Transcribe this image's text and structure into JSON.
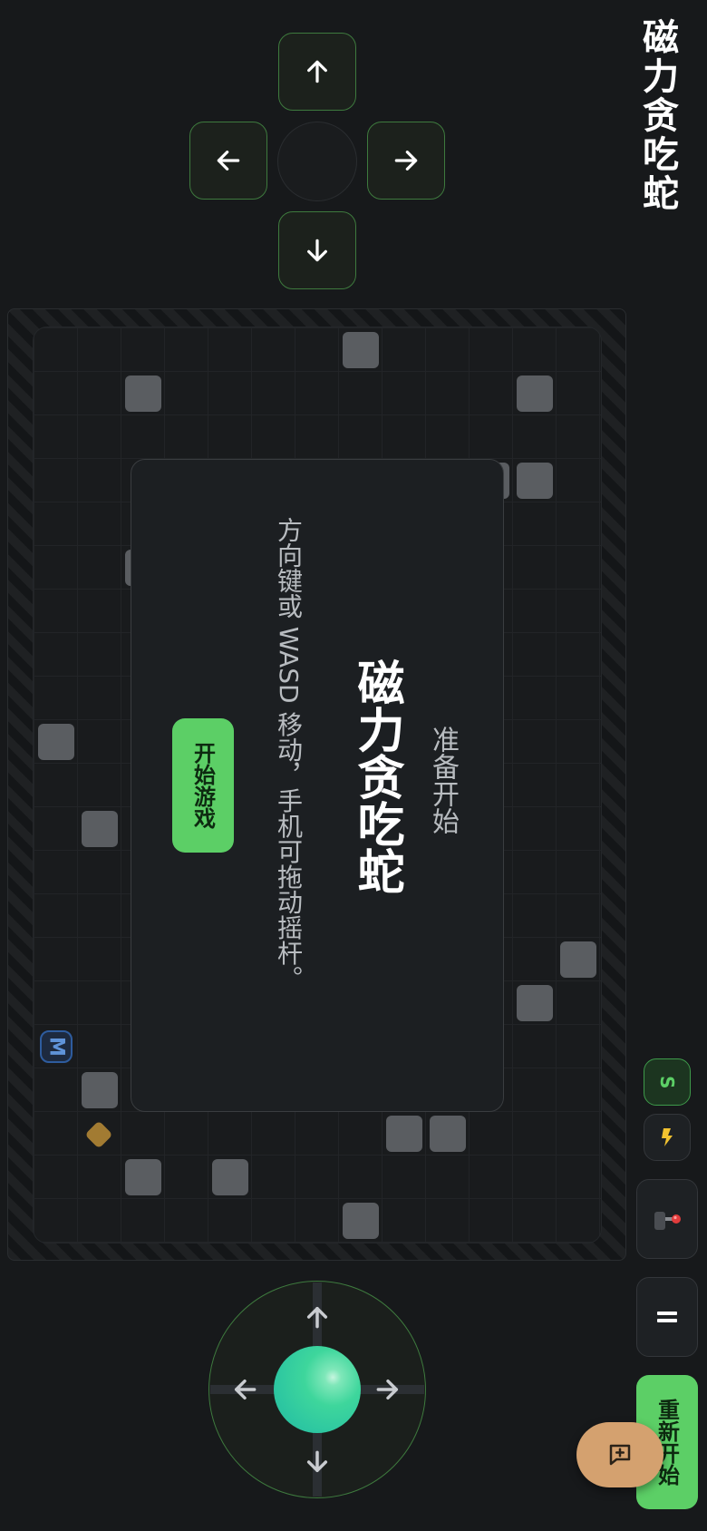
{
  "game": {
    "title": "磁力贪吃蛇"
  },
  "dpad": {
    "up_icon": "arrow-up-icon",
    "left_icon": "arrow-left-icon",
    "right_icon": "arrow-right-icon",
    "down_icon": "arrow-down-icon"
  },
  "board": {
    "magnet_label": "M",
    "item_colors": {
      "block": "#5a5d61",
      "magnet": "#2e5c9e",
      "coin": "#a27b32"
    }
  },
  "modal": {
    "status": "准备开始",
    "title": "磁力贪吃蛇",
    "instructions": "方向键或 WASD 移动，手机可拖动摇杆。",
    "start_label": "开始游戏"
  },
  "side": {
    "badge_s": "S",
    "boost_icon": "lightning-icon",
    "joystick_icon": "joystick-icon",
    "pause_icon": "pause-icon",
    "restart_label": "重新开始",
    "feedback_icon": "chat-plus-icon"
  },
  "colors": {
    "accent_green": "#5ccf66",
    "border_green": "#3e7a3e",
    "background": "#17191b",
    "feedback_bg": "#d4a16f"
  }
}
